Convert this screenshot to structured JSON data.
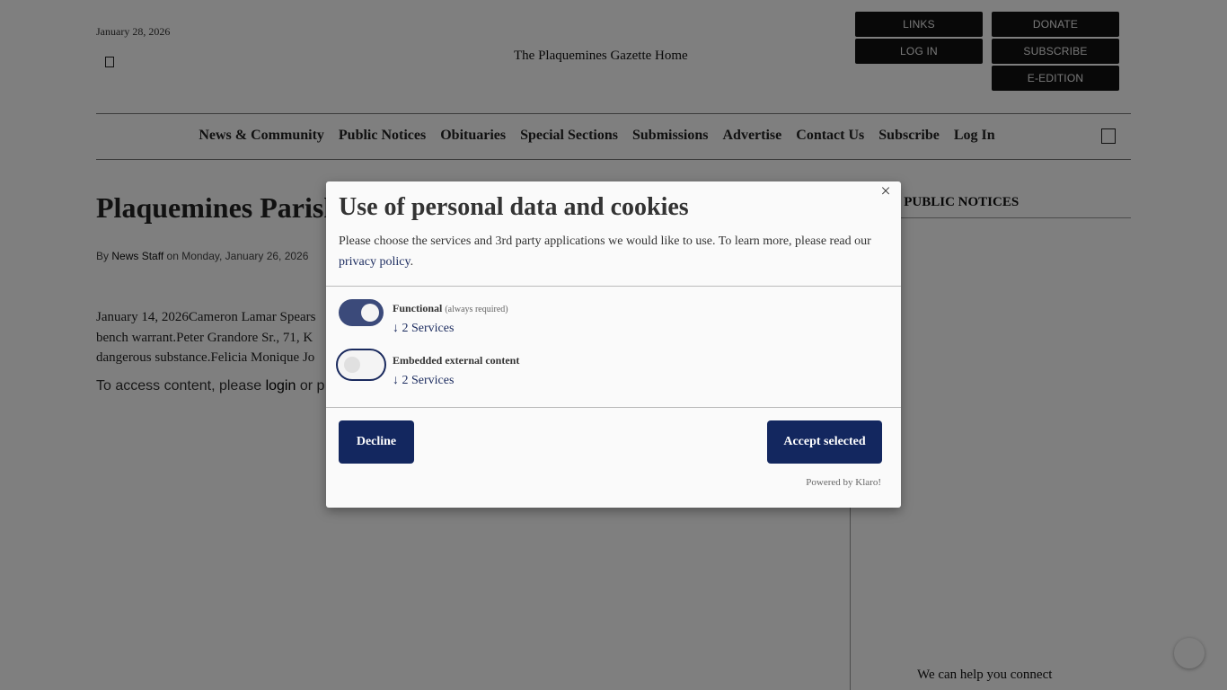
{
  "header": {
    "date": "January 28, 2026",
    "logo_alt": "The Plaquemines Gazette Home",
    "buttons": {
      "links": "LINKS",
      "log_in": "LOG IN",
      "donate": "DONATE",
      "subscribe": "SUBSCRIBE",
      "e_edition": "E-EDITION"
    }
  },
  "nav": {
    "items": [
      "News & Community",
      "Public Notices",
      "Obituaries",
      "Special Sections",
      "Submissions",
      "Advertise",
      "Contact Us",
      "Subscribe",
      "Log In"
    ]
  },
  "article": {
    "title": "Plaquemines Parish",
    "by_prefix": "By",
    "author": "News Staff",
    "date_prefix": "on Monday, January 26, 2026",
    "body_lines": [
      "January 14, 2026Cameron Lamar Spears",
      "bench warrant.Peter Grandore Sr., 71, K",
      "dangerous substance.Felicia Monique Jo"
    ],
    "access_text": "To access content, please",
    "login_link": "login",
    "access_tail": "or p"
  },
  "sidebar": {
    "heading": "CH PUBLIC NOTICES",
    "ad_alt": "We can help you connect"
  },
  "modal": {
    "title": "Use of personal data and cookies",
    "description": "Please choose the services and 3rd party applications we would like to use. To learn more, please read our",
    "privacy_link": "privacy policy",
    "services": [
      {
        "name": "Functional",
        "note": "(always required)",
        "count": "↓ 2 Services",
        "enabled": true
      },
      {
        "name": "Embedded external content",
        "note": "",
        "count": "↓ 2 Services",
        "enabled": false
      }
    ],
    "decline_label": "Decline",
    "accept_label": "Accept selected",
    "powered_by": "Powered by Klaro!"
  },
  "icons": {
    "close": "close-icon",
    "search": "search-icon",
    "menu": "menu-icon"
  },
  "colors": {
    "accent": "#13275f",
    "overlay": "rgba(0,0,0,0.5)"
  }
}
